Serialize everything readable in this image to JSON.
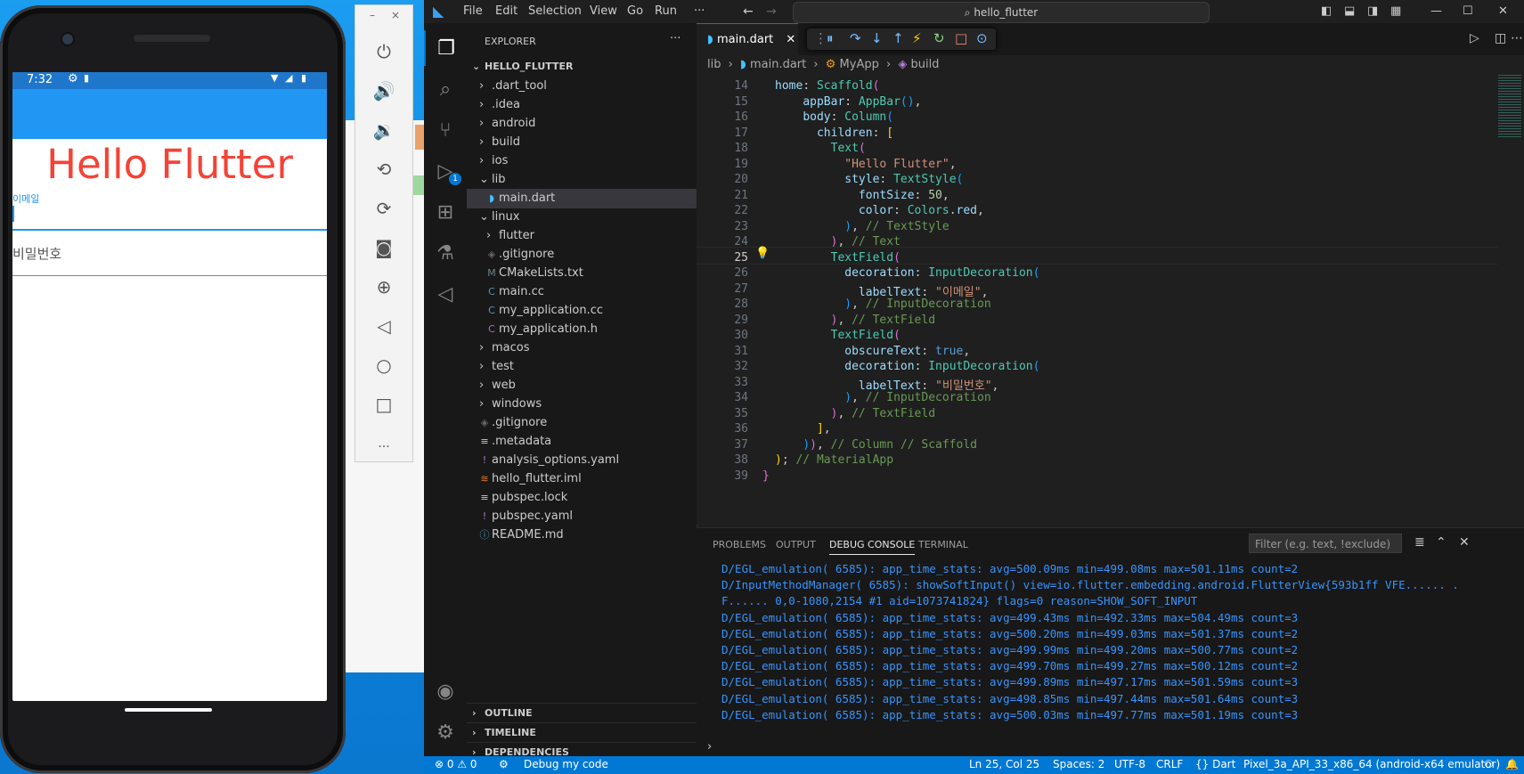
{
  "phone": {
    "status_time": "7:32",
    "hello_text": "Hello Flutter",
    "email_label": "이메일",
    "password_label": "비밀번호"
  },
  "emulator_toolbar": {
    "minimize": "–",
    "close": "×",
    "more": "..."
  },
  "vscode": {
    "menu": [
      "File",
      "Edit",
      "Selection",
      "View",
      "Go",
      "Run",
      "···"
    ],
    "search_text": "hello_flutter",
    "sidebar_title": "EXPLORER",
    "sidebar_more": "···",
    "project": "HELLO_FLUTTER",
    "tree": [
      {
        "label": ".dart_tool",
        "type": "folder",
        "depth": 1
      },
      {
        "label": ".idea",
        "type": "folder",
        "depth": 1
      },
      {
        "label": "android",
        "type": "folder",
        "depth": 1
      },
      {
        "label": "build",
        "type": "folder",
        "depth": 1
      },
      {
        "label": "ios",
        "type": "folder",
        "depth": 1
      },
      {
        "label": "lib",
        "type": "folder-open",
        "depth": 1
      },
      {
        "label": "main.dart",
        "type": "dart",
        "depth": 2,
        "selected": true
      },
      {
        "label": "linux",
        "type": "folder-open",
        "depth": 1
      },
      {
        "label": "flutter",
        "type": "folder",
        "depth": 2
      },
      {
        "label": ".gitignore",
        "type": "git",
        "depth": 2
      },
      {
        "label": "CMakeLists.txt",
        "type": "cmake",
        "depth": 2
      },
      {
        "label": "main.cc",
        "type": "cpp",
        "depth": 2
      },
      {
        "label": "my_application.cc",
        "type": "cpp",
        "depth": 2
      },
      {
        "label": "my_application.h",
        "type": "h",
        "depth": 2
      },
      {
        "label": "macos",
        "type": "folder",
        "depth": 1
      },
      {
        "label": "test",
        "type": "folder",
        "depth": 1
      },
      {
        "label": "web",
        "type": "folder",
        "depth": 1
      },
      {
        "label": "windows",
        "type": "folder",
        "depth": 1
      },
      {
        "label": ".gitignore",
        "type": "git",
        "depth": 1
      },
      {
        "label": ".metadata",
        "type": "meta",
        "depth": 1
      },
      {
        "label": "analysis_options.yaml",
        "type": "yaml",
        "depth": 1
      },
      {
        "label": "hello_flutter.iml",
        "type": "iml",
        "depth": 1
      },
      {
        "label": "pubspec.lock",
        "type": "lock",
        "depth": 1
      },
      {
        "label": "pubspec.yaml",
        "type": "yaml",
        "depth": 1
      },
      {
        "label": "README.md",
        "type": "md",
        "depth": 1
      }
    ],
    "sections": [
      "OUTLINE",
      "TIMELINE",
      "DEPENDENCIES"
    ],
    "tab_label": "main.dart",
    "breadcrumb": [
      "lib",
      "main.dart",
      "MyApp",
      "build"
    ],
    "line_numbers": [
      "14",
      "15",
      "16",
      "17",
      "18",
      "19",
      "20",
      "21",
      "22",
      "23",
      "24",
      "25",
      "26",
      "27",
      "28",
      "29",
      "30",
      "31",
      "32",
      "33",
      "34",
      "35",
      "36",
      "37",
      "38",
      "39"
    ],
    "panel_tabs": [
      "PROBLEMS",
      "OUTPUT",
      "DEBUG CONSOLE",
      "TERMINAL"
    ],
    "filter_placeholder": "Filter (e.g. text, !exclude)",
    "logs": [
      "D/EGL_emulation( 6585): app_time_stats: avg=500.09ms min=499.08ms max=501.11ms count=2",
      "D/InputMethodManager( 6585): showSoftInput() view=io.flutter.embedding.android.FlutterView{593b1ff VFE...... .",
      "F...... 0,0-1080,2154 #1 aid=1073741824} flags=0 reason=SHOW_SOFT_INPUT",
      "D/EGL_emulation( 6585): app_time_stats: avg=499.43ms min=492.33ms max=504.49ms count=3",
      "D/EGL_emulation( 6585): app_time_stats: avg=500.20ms min=499.03ms max=501.37ms count=2",
      "D/EGL_emulation( 6585): app_time_stats: avg=499.99ms min=499.20ms max=500.77ms count=2",
      "D/EGL_emulation( 6585): app_time_stats: avg=499.70ms min=499.27ms max=500.12ms count=2",
      "D/EGL_emulation( 6585): app_time_stats: avg=499.89ms min=497.17ms max=501.59ms count=3",
      "D/EGL_emulation( 6585): app_time_stats: avg=498.85ms min=497.44ms max=501.64ms count=3",
      "D/EGL_emulation( 6585): app_time_stats: avg=500.03ms min=497.77ms max=501.19ms count=3"
    ],
    "status": {
      "errors": "⊗ 0 ⚠ 0",
      "debug": "Debug my code",
      "position": "Ln 25, Col 25",
      "spaces": "Spaces: 2",
      "encoding": "UTF-8",
      "eol": "CRLF",
      "lang": "{} Dart",
      "device": "Pixel_3a_API_33_x86_64 (android-x64 emulator)"
    },
    "debug_badge": "1"
  },
  "colors": {
    "accent": "#0078d4",
    "flutter_red": "#f44336",
    "appbar_blue": "#2196f3"
  }
}
